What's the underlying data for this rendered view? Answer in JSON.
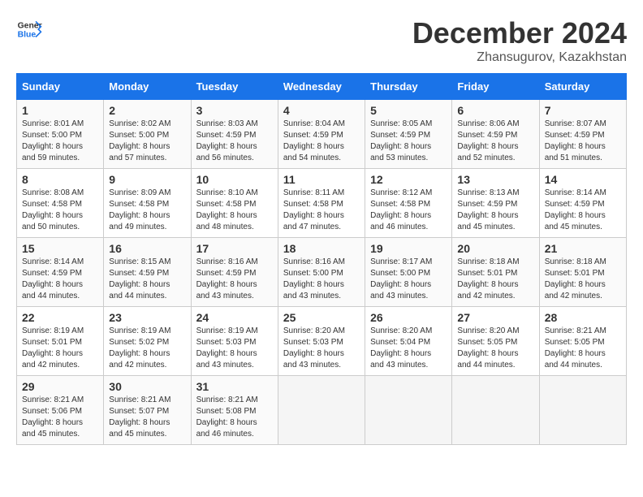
{
  "header": {
    "logo_text_normal": "General",
    "logo_text_blue": "Blue",
    "month": "December 2024",
    "location": "Zhansugurov, Kazakhstan"
  },
  "calendar": {
    "weekdays": [
      "Sunday",
      "Monday",
      "Tuesday",
      "Wednesday",
      "Thursday",
      "Friday",
      "Saturday"
    ],
    "weeks": [
      [
        null,
        {
          "day": 2,
          "sunrise": "8:02 AM",
          "sunset": "5:00 PM",
          "daylight": "8 hours and 57 minutes."
        },
        {
          "day": 3,
          "sunrise": "8:03 AM",
          "sunset": "4:59 PM",
          "daylight": "8 hours and 56 minutes."
        },
        {
          "day": 4,
          "sunrise": "8:04 AM",
          "sunset": "4:59 PM",
          "daylight": "8 hours and 54 minutes."
        },
        {
          "day": 5,
          "sunrise": "8:05 AM",
          "sunset": "4:59 PM",
          "daylight": "8 hours and 53 minutes."
        },
        {
          "day": 6,
          "sunrise": "8:06 AM",
          "sunset": "4:59 PM",
          "daylight": "8 hours and 52 minutes."
        },
        {
          "day": 7,
          "sunrise": "8:07 AM",
          "sunset": "4:59 PM",
          "daylight": "8 hours and 51 minutes."
        }
      ],
      [
        {
          "day": 1,
          "sunrise": "8:01 AM",
          "sunset": "5:00 PM",
          "daylight": "8 hours and 59 minutes."
        },
        {
          "day": 9,
          "sunrise": "8:09 AM",
          "sunset": "4:58 PM",
          "daylight": "8 hours and 49 minutes."
        },
        {
          "day": 10,
          "sunrise": "8:10 AM",
          "sunset": "4:58 PM",
          "daylight": "8 hours and 48 minutes."
        },
        {
          "day": 11,
          "sunrise": "8:11 AM",
          "sunset": "4:58 PM",
          "daylight": "8 hours and 47 minutes."
        },
        {
          "day": 12,
          "sunrise": "8:12 AM",
          "sunset": "4:58 PM",
          "daylight": "8 hours and 46 minutes."
        },
        {
          "day": 13,
          "sunrise": "8:13 AM",
          "sunset": "4:59 PM",
          "daylight": "8 hours and 45 minutes."
        },
        {
          "day": 14,
          "sunrise": "8:14 AM",
          "sunset": "4:59 PM",
          "daylight": "8 hours and 45 minutes."
        }
      ],
      [
        {
          "day": 8,
          "sunrise": "8:08 AM",
          "sunset": "4:58 PM",
          "daylight": "8 hours and 50 minutes."
        },
        {
          "day": 16,
          "sunrise": "8:15 AM",
          "sunset": "4:59 PM",
          "daylight": "8 hours and 44 minutes."
        },
        {
          "day": 17,
          "sunrise": "8:16 AM",
          "sunset": "4:59 PM",
          "daylight": "8 hours and 43 minutes."
        },
        {
          "day": 18,
          "sunrise": "8:16 AM",
          "sunset": "5:00 PM",
          "daylight": "8 hours and 43 minutes."
        },
        {
          "day": 19,
          "sunrise": "8:17 AM",
          "sunset": "5:00 PM",
          "daylight": "8 hours and 43 minutes."
        },
        {
          "day": 20,
          "sunrise": "8:18 AM",
          "sunset": "5:01 PM",
          "daylight": "8 hours and 42 minutes."
        },
        {
          "day": 21,
          "sunrise": "8:18 AM",
          "sunset": "5:01 PM",
          "daylight": "8 hours and 42 minutes."
        }
      ],
      [
        {
          "day": 15,
          "sunrise": "8:14 AM",
          "sunset": "4:59 PM",
          "daylight": "8 hours and 44 minutes."
        },
        {
          "day": 23,
          "sunrise": "8:19 AM",
          "sunset": "5:02 PM",
          "daylight": "8 hours and 42 minutes."
        },
        {
          "day": 24,
          "sunrise": "8:19 AM",
          "sunset": "5:03 PM",
          "daylight": "8 hours and 43 minutes."
        },
        {
          "day": 25,
          "sunrise": "8:20 AM",
          "sunset": "5:03 PM",
          "daylight": "8 hours and 43 minutes."
        },
        {
          "day": 26,
          "sunrise": "8:20 AM",
          "sunset": "5:04 PM",
          "daylight": "8 hours and 43 minutes."
        },
        {
          "day": 27,
          "sunrise": "8:20 AM",
          "sunset": "5:05 PM",
          "daylight": "8 hours and 44 minutes."
        },
        {
          "day": 28,
          "sunrise": "8:21 AM",
          "sunset": "5:05 PM",
          "daylight": "8 hours and 44 minutes."
        }
      ],
      [
        {
          "day": 22,
          "sunrise": "8:19 AM",
          "sunset": "5:01 PM",
          "daylight": "8 hours and 42 minutes."
        },
        {
          "day": 30,
          "sunrise": "8:21 AM",
          "sunset": "5:07 PM",
          "daylight": "8 hours and 45 minutes."
        },
        {
          "day": 31,
          "sunrise": "8:21 AM",
          "sunset": "5:08 PM",
          "daylight": "8 hours and 46 minutes."
        },
        null,
        null,
        null,
        null
      ],
      [
        {
          "day": 29,
          "sunrise": "8:21 AM",
          "sunset": "5:06 PM",
          "daylight": "8 hours and 45 minutes."
        },
        null,
        null,
        null,
        null,
        null,
        null
      ]
    ]
  }
}
